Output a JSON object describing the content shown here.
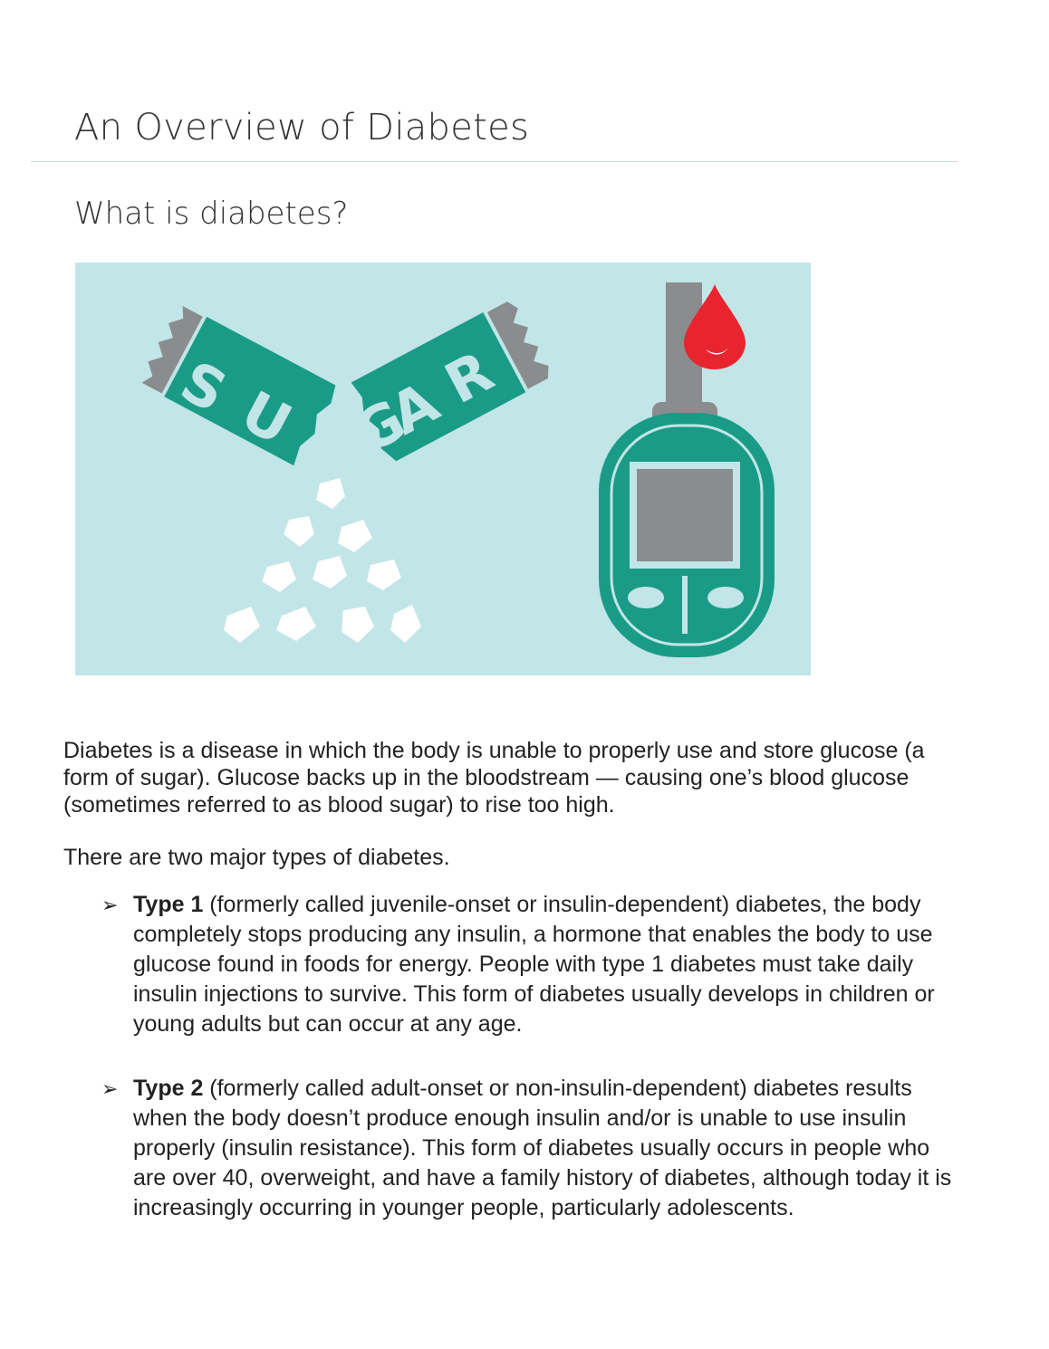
{
  "page": {
    "title": "An Overview of Diabetes",
    "subtitle": "What is diabetes?"
  },
  "illustration": {
    "wrapper_text": "SUGAR",
    "background_color": "#c2e5e7",
    "accent_color": "#1a9b88",
    "drop_color": "#e8242f"
  },
  "body": {
    "intro": "Diabetes is a disease in which the body is unable to properly use and store glucose (a form of sugar). Glucose backs up in the bloodstream — causing one’s blood glucose (sometimes referred to as blood sugar) to rise too high.",
    "types_intro": "There are two major types of diabetes.",
    "types": [
      {
        "bullet": "➢",
        "name": "Type 1",
        "description": " (formerly called juvenile-onset or insulin-dependent) diabetes, the body completely stops producing any insulin, a hormone that enables the body to use glucose found in foods for energy. People with type 1 diabetes must take daily insulin injections to survive. This form of diabetes usually develops in children or young adults but can occur at any age."
      },
      {
        "bullet": "➢",
        "name": "Type 2",
        "description": " (formerly called adult-onset or non-insulin-dependent) diabetes results when the body doesn’t produce enough insulin and/or is unable to use insulin properly (insulin resistance). This form of diabetes usually occurs in people who are over 40, overweight, and have a family history of diabetes, although today it is increasingly occurring in younger people, particularly adolescents."
      }
    ]
  }
}
